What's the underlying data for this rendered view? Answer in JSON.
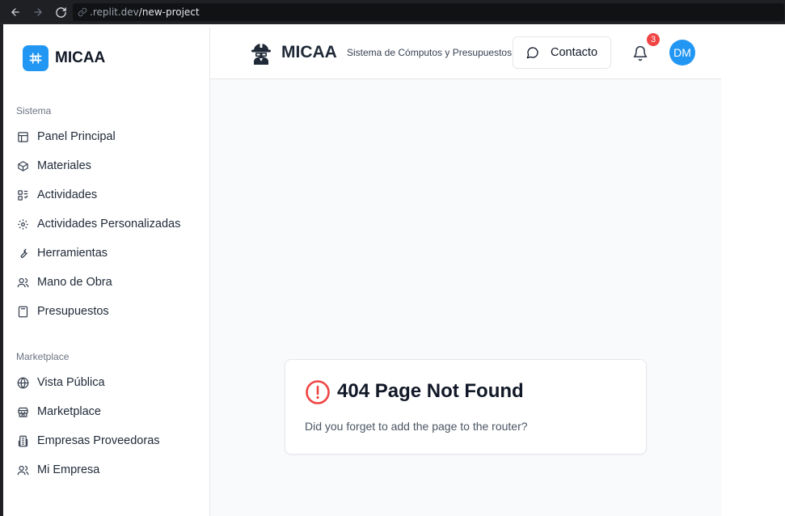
{
  "browser": {
    "url_host": ".replit.dev",
    "url_path": "/new-project"
  },
  "sidebar": {
    "brand": "MICAA",
    "section_sistema": "Sistema",
    "section_marketplace": "Marketplace",
    "sistema_items": [
      {
        "label": "Panel Principal",
        "icon": "layout-icon"
      },
      {
        "label": "Materiales",
        "icon": "box-icon"
      },
      {
        "label": "Actividades",
        "icon": "activities-icon"
      },
      {
        "label": "Actividades Personalizadas",
        "icon": "gear-icon"
      },
      {
        "label": "Herramientas",
        "icon": "wrench-icon"
      },
      {
        "label": "Mano de Obra",
        "icon": "users-icon"
      },
      {
        "label": "Presupuestos",
        "icon": "calculator-icon"
      }
    ],
    "marketplace_items": [
      {
        "label": "Vista Pública",
        "icon": "globe-icon"
      },
      {
        "label": "Marketplace",
        "icon": "store-icon"
      },
      {
        "label": "Empresas Proveedoras",
        "icon": "building-icon"
      },
      {
        "label": "Mi Empresa",
        "icon": "users-icon"
      }
    ]
  },
  "header": {
    "title": "MICAA",
    "subtitle": "Sistema de Cómputos y Presupuestos",
    "contact_label": "Contacto",
    "notification_count": "3",
    "avatar_initials": "DM"
  },
  "error_card": {
    "title": "404 Page Not Found",
    "message": "Did you forget to add the page to the router?"
  },
  "colors": {
    "accent": "#2196f3",
    "badge": "#ef4444",
    "error_icon": "#ef4444"
  }
}
